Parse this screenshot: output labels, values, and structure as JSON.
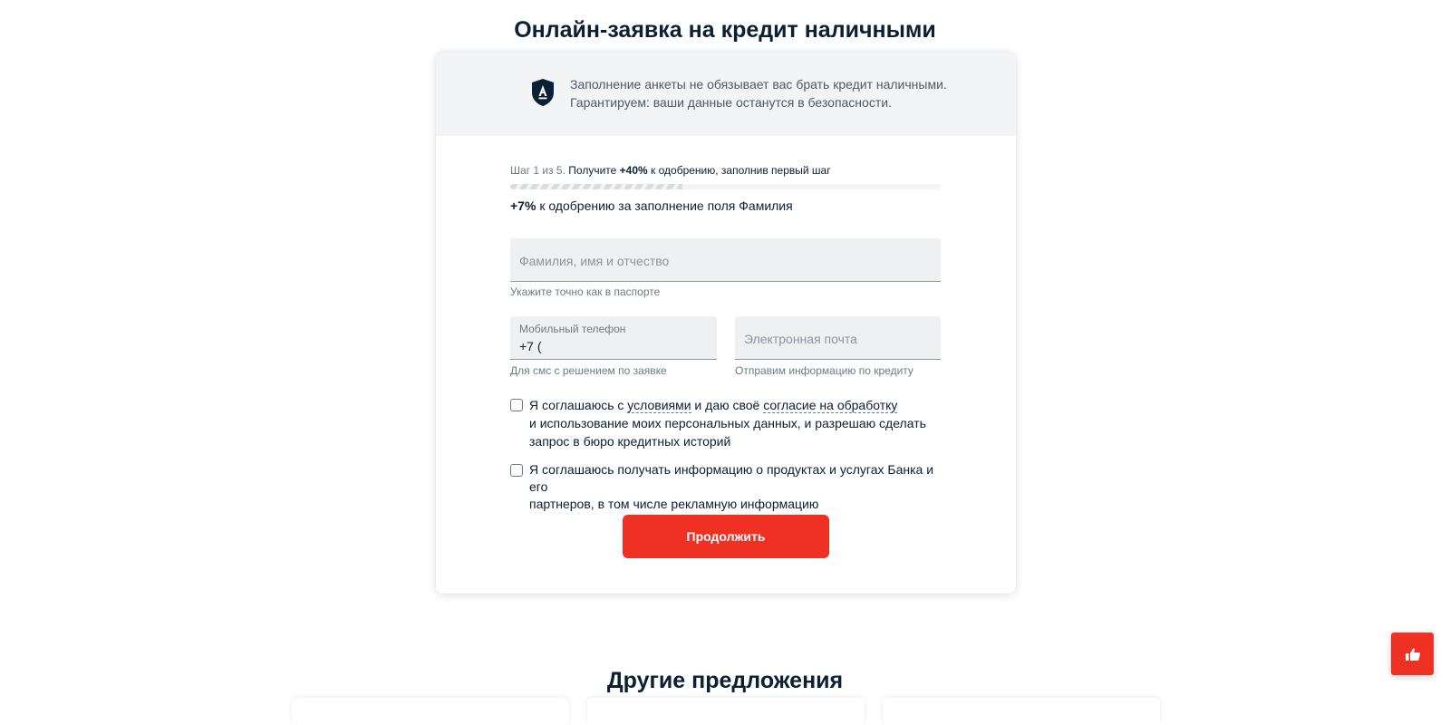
{
  "page": {
    "title": "Онлайн-заявка на кредит наличными"
  },
  "notice": {
    "line1": "Заполнение анкеты не обязывает вас брать кредит наличными.",
    "line2": "Гарантируем: ваши данные останутся в безопасности.",
    "icon": "shield-logo-icon"
  },
  "progress": {
    "step_label": "Шаг 1 из 5.",
    "prefix": "Получите",
    "boost": "+40%",
    "suffix": "к одобрению, заполнив первый шаг",
    "fill_fraction": 0.4,
    "bonus_value": "+7%",
    "bonus_text": "к одобрению за заполнение поля Фамилия"
  },
  "form": {
    "fio": {
      "placeholder": "Фамилия, имя и отчество",
      "value": "",
      "hint": "Укажите точно как в паспорте"
    },
    "phone": {
      "label": "Мобильный телефон",
      "value": "+7 (",
      "hint": "Для смс с решением по заявке"
    },
    "email": {
      "placeholder": "Электронная почта",
      "value": "",
      "hint": "Отправим информацию по кредиту"
    },
    "consent1": {
      "part1": "Я соглашаюсь с ",
      "link1": "условиями",
      "part2": " и даю своё ",
      "link2": "согласие на обработку",
      "line2": "и использование моих персональных данных, и разрешаю сделать",
      "line3": "запрос в бюро кредитных историй",
      "checked": false
    },
    "consent2": {
      "line1": "Я соглашаюсь получать информацию о продуктах и услугах Банка и его",
      "line2": "партнеров, в том числе рекламную информацию",
      "checked": false
    },
    "submit_label": "Продолжить"
  },
  "other": {
    "title": "Другие предложения"
  },
  "feedback": {
    "icon": "thumbs-up-icon"
  },
  "colors": {
    "accent": "#ef3124",
    "text": "#0b1f35",
    "field_bg": "#eff0f2",
    "notice_bg": "#f3f4f5"
  }
}
